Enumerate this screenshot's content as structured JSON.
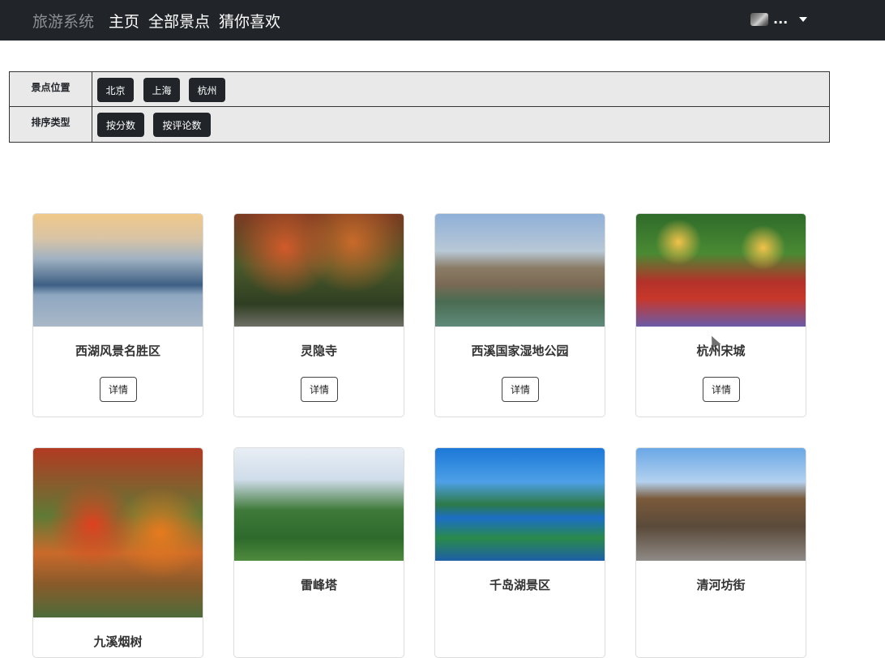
{
  "navbar": {
    "brand": "旅游系统",
    "links": [
      "主页",
      "全部景点",
      "猜你喜欢"
    ],
    "user_name": "..."
  },
  "filters": {
    "location_label": "景点位置",
    "locations": [
      "北京",
      "上海",
      "杭州"
    ],
    "sort_label": "排序类型",
    "sorts": [
      "按分数",
      "按评论数"
    ]
  },
  "cards": [
    {
      "title": "西湖风景名胜区",
      "detail": "详情"
    },
    {
      "title": "灵隐寺",
      "detail": "详情"
    },
    {
      "title": "西溪国家湿地公园",
      "detail": "详情"
    },
    {
      "title": "杭州宋城",
      "detail": "详情"
    },
    {
      "title": "九溪烟树"
    },
    {
      "title": "雷峰塔"
    },
    {
      "title": "千岛湖景区"
    },
    {
      "title": "清河坊街"
    }
  ]
}
